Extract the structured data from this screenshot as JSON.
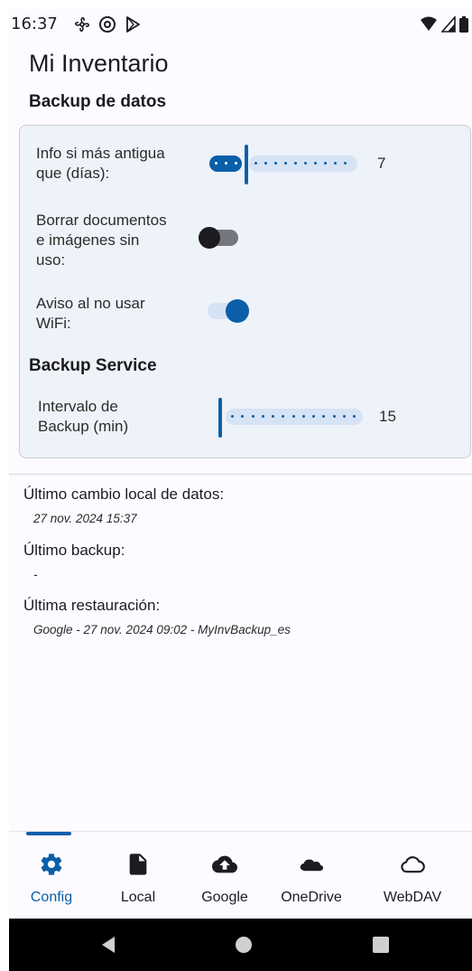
{
  "status_bar": {
    "time": "16:37"
  },
  "header": {
    "title": "Mi Inventario",
    "subtitle": "Backup de datos"
  },
  "settings": {
    "info_older": {
      "label_line1": "Info si más antigua",
      "label_line2": "que (días):",
      "value": "7",
      "slider_fraction": 0.12
    },
    "delete_unused": {
      "label_line1": "Borrar documentos",
      "label_line2": "e imágenes sin",
      "label_line3": "uso:",
      "on": false
    },
    "wifi_warning": {
      "label_line1": "Aviso al no usar",
      "label_line2": "WiFi:",
      "on": true
    },
    "backup_service": {
      "title": "Backup Service",
      "interval_label_line1": "Intervalo de",
      "interval_label_line2": "Backup (min)",
      "interval_value": "15",
      "slider_fraction": 0.0
    }
  },
  "info": {
    "last_local_change_label": "Último cambio local de datos:",
    "last_local_change_value": "27 nov. 2024 15:37",
    "last_backup_label": "Último backup:",
    "last_backup_value": "-",
    "last_restore_label": "Última restauración:",
    "last_restore_value": "Google - 27 nov. 2024 09:02 - MyInvBackup_es"
  },
  "bottom_nav": {
    "items": [
      {
        "label": "Config",
        "icon": "gear-icon",
        "active": true
      },
      {
        "label": "Local",
        "icon": "document-icon",
        "active": false
      },
      {
        "label": "Google",
        "icon": "cloud-upload-icon",
        "active": false
      },
      {
        "label": "OneDrive",
        "icon": "onedrive-cloud-icon",
        "active": false
      },
      {
        "label": "WebDAV",
        "icon": "cloud-outline-icon",
        "active": false
      }
    ]
  },
  "colors": {
    "accent": "#0a5fa8",
    "card_background": "#eef2f9",
    "page_background": "#fdfbff"
  }
}
